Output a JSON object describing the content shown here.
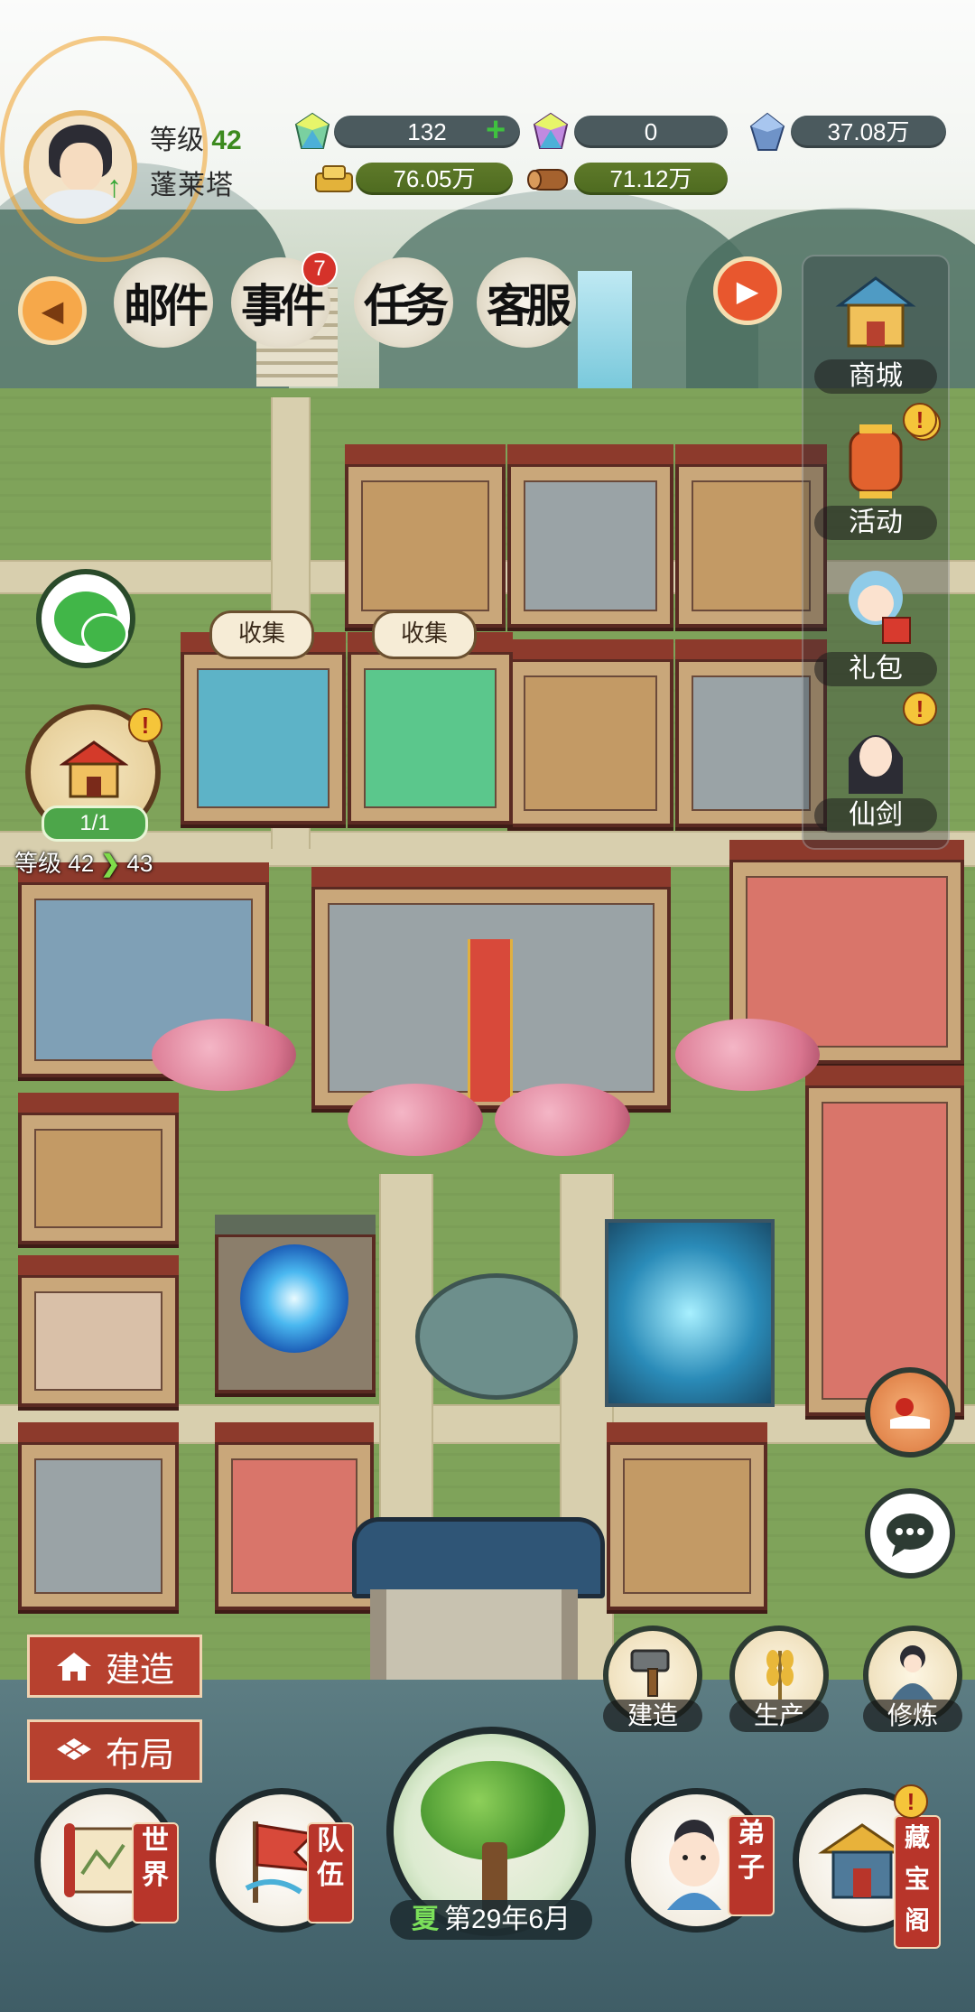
{
  "player": {
    "level_label": "等级",
    "level_value": "42",
    "realm": "蓬莱塔"
  },
  "resources": {
    "jade": "132",
    "jade_bound": "0",
    "crystal": "37.08万",
    "gold": "76.05万",
    "wood": "71.12万"
  },
  "tabs": [
    {
      "label": "邮件"
    },
    {
      "label": "事件",
      "badge": "7"
    },
    {
      "label": "任务"
    },
    {
      "label": "客服"
    }
  ],
  "right_panel": [
    {
      "label": "商城"
    },
    {
      "label": "活动"
    },
    {
      "label": "礼包"
    },
    {
      "label": "仙剑"
    }
  ],
  "sect": {
    "count": "1/1",
    "level_label": "等级",
    "level_from": "42",
    "level_to": "43"
  },
  "collect_label": "收集",
  "left_actions": {
    "build": "建造",
    "layout": "布局"
  },
  "action_buttons": [
    {
      "label": "建造"
    },
    {
      "label": "生产"
    },
    {
      "label": "修炼"
    }
  ],
  "bottom_nav": [
    {
      "label": "世界"
    },
    {
      "label": "队伍"
    },
    {
      "label": "弟子"
    },
    {
      "label": "藏宝阁"
    }
  ],
  "date": {
    "season": "夏",
    "text": "第29年6月"
  },
  "colors": {
    "grass": "#7fa35a",
    "accent_red": "#b7412f",
    "level_green": "#3c8a1e",
    "badge_red": "#d5322a"
  }
}
